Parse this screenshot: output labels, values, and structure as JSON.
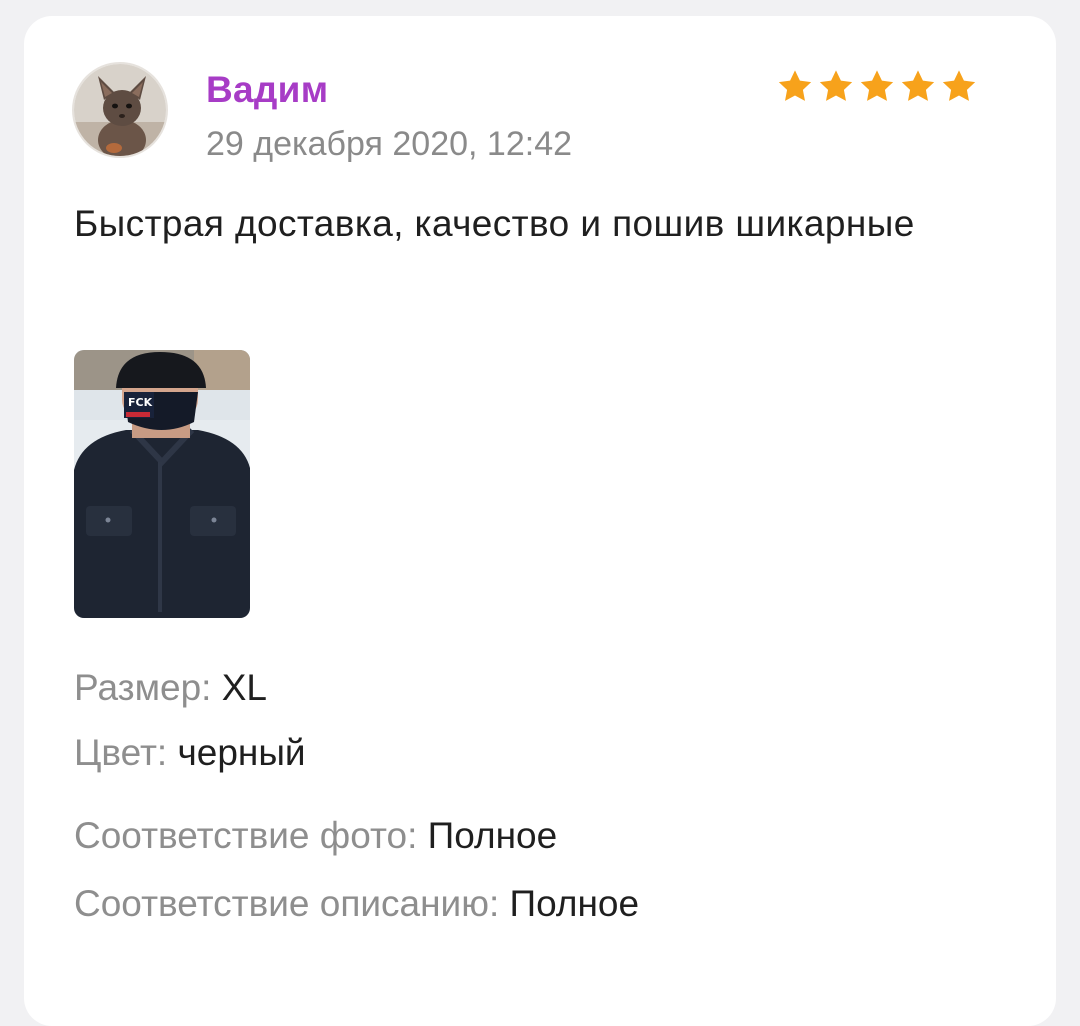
{
  "review": {
    "author": "Вадим",
    "date": "29 декабря 2020, 12:42",
    "rating": 5,
    "text": "Быстрая доставка, качество и пошив шикарные",
    "photo_caption": "FCK"
  },
  "attributes": [
    {
      "label": "Размер:",
      "value": "XL"
    },
    {
      "label": "Цвет:",
      "value": "черный"
    },
    {
      "label": "Соответствие фото:",
      "value": "Полное"
    },
    {
      "label": "Соответствие описанию:",
      "value": "Полное"
    }
  ],
  "colors": {
    "author": "#a73cc6",
    "star": "#f7a21b",
    "secondary_text": "#8e8e8e",
    "primary_text": "#1f1f1f",
    "background": "#f1f1f3",
    "card": "#ffffff"
  },
  "icons": {
    "rating": "star-icon"
  }
}
